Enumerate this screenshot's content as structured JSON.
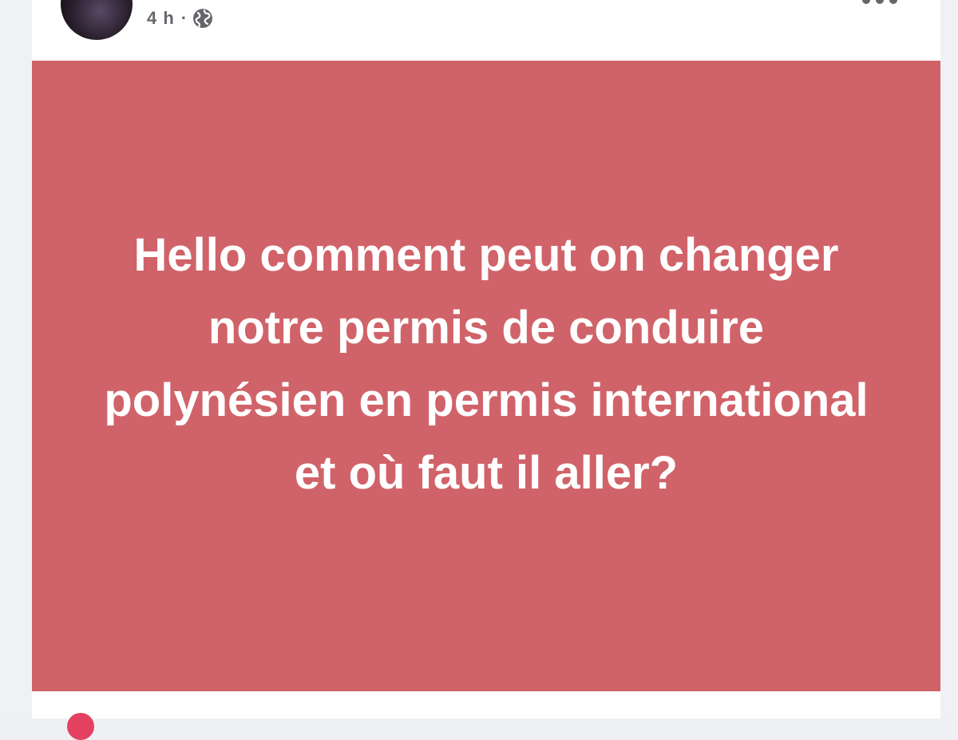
{
  "post": {
    "timestamp": "4 h",
    "separator": "·",
    "audience_icon": "globe-icon",
    "menu_icon": "more-options-icon",
    "text": "Hello comment peut on changer notre permis de conduire polynésien en permis international et où faut il aller?",
    "background_color": "#d06369",
    "text_color": "#ffffff"
  },
  "footer": {
    "reaction_icon": "reaction-icon"
  }
}
